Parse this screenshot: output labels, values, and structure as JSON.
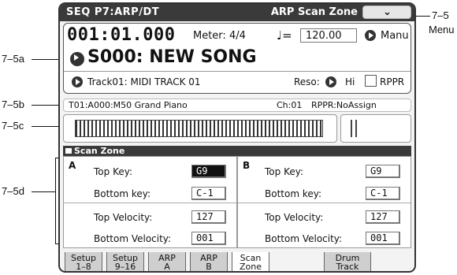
{
  "callouts": {
    "menu_num": "7–5",
    "menu_word": "Menu",
    "a": "7–5a",
    "b": "7–5b",
    "c": "7–5c",
    "d": "7–5d"
  },
  "titlebar": {
    "page": "SEQ P7:ARP/DT",
    "tab_title": "ARP Scan Zone",
    "menu_icon": "chevron-down-icon"
  },
  "song": {
    "location": "001:01.000",
    "meter": "Meter: 4/4",
    "tempo_note": "♩",
    "tempo_eq": "=",
    "tempo_value": "120.00",
    "tempo_mode": "Manu",
    "name": "S000: NEW SONG",
    "track": "Track01: MIDI TRACK 01",
    "reso_label": "Reso:",
    "reso_value": "Hi",
    "rppr_label": "RPPR"
  },
  "track_info": {
    "track": "T01:A000:M50 Grand Piano",
    "channel": "Ch:01",
    "rppr": "RPPR:NoAssign"
  },
  "scan_zone": {
    "title": "Scan Zone",
    "a": {
      "letter": "A",
      "top_key_label": "Top Key:",
      "top_key": "G9",
      "bottom_key_label": "Bottom key:",
      "bottom_key": "C-1",
      "top_vel_label": "Top Velocity:",
      "top_vel": "127",
      "bottom_vel_label": "Bottom Velocity:",
      "bottom_vel": "001"
    },
    "b": {
      "letter": "B",
      "top_key_label": "Top Key:",
      "top_key": "G9",
      "bottom_key_label": "Bottom key:",
      "bottom_key": "C-1",
      "top_vel_label": "Top Velocity:",
      "top_vel": "127",
      "bottom_vel_label": "Bottom Velocity:",
      "bottom_vel": "001"
    }
  },
  "tabs": [
    {
      "line1": "Setup",
      "line2": "1–8"
    },
    {
      "line1": "Setup",
      "line2": "9–16"
    },
    {
      "line1": "ARP",
      "line2": "A"
    },
    {
      "line1": "ARP",
      "line2": "B"
    },
    {
      "line1": "Scan",
      "line2": "Zone"
    },
    {
      "line1": "Drum",
      "line2": "Track"
    }
  ]
}
